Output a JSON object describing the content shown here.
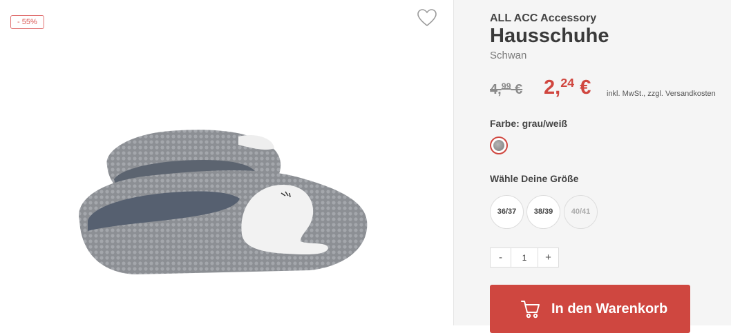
{
  "product": {
    "discount_badge": "- 55%",
    "brand": "ALL ACC Accessory",
    "title": "Hausschuhe",
    "subtitle": "Schwan"
  },
  "price": {
    "old_main": "4,",
    "old_cents": "99",
    "old_currency": "€",
    "new_main": "2,",
    "new_cents": "24",
    "new_currency": "€",
    "tax_note": "inkl. MwSt., zzgl. Versandkosten"
  },
  "color": {
    "label": "Farbe: grau/weiß",
    "accent": "#d0463f"
  },
  "sizes": {
    "label": "Wähle Deine Größe",
    "options": [
      {
        "label": "36/37",
        "available": true
      },
      {
        "label": "38/39",
        "available": true
      },
      {
        "label": "40/41",
        "available": false
      }
    ]
  },
  "quantity": {
    "minus": "-",
    "value": "1",
    "plus": "+"
  },
  "cart": {
    "label": "In den Warenkorb",
    "icon": "cart-icon",
    "color": "#cf4740"
  },
  "icons": {
    "wishlist": "heart-icon"
  }
}
